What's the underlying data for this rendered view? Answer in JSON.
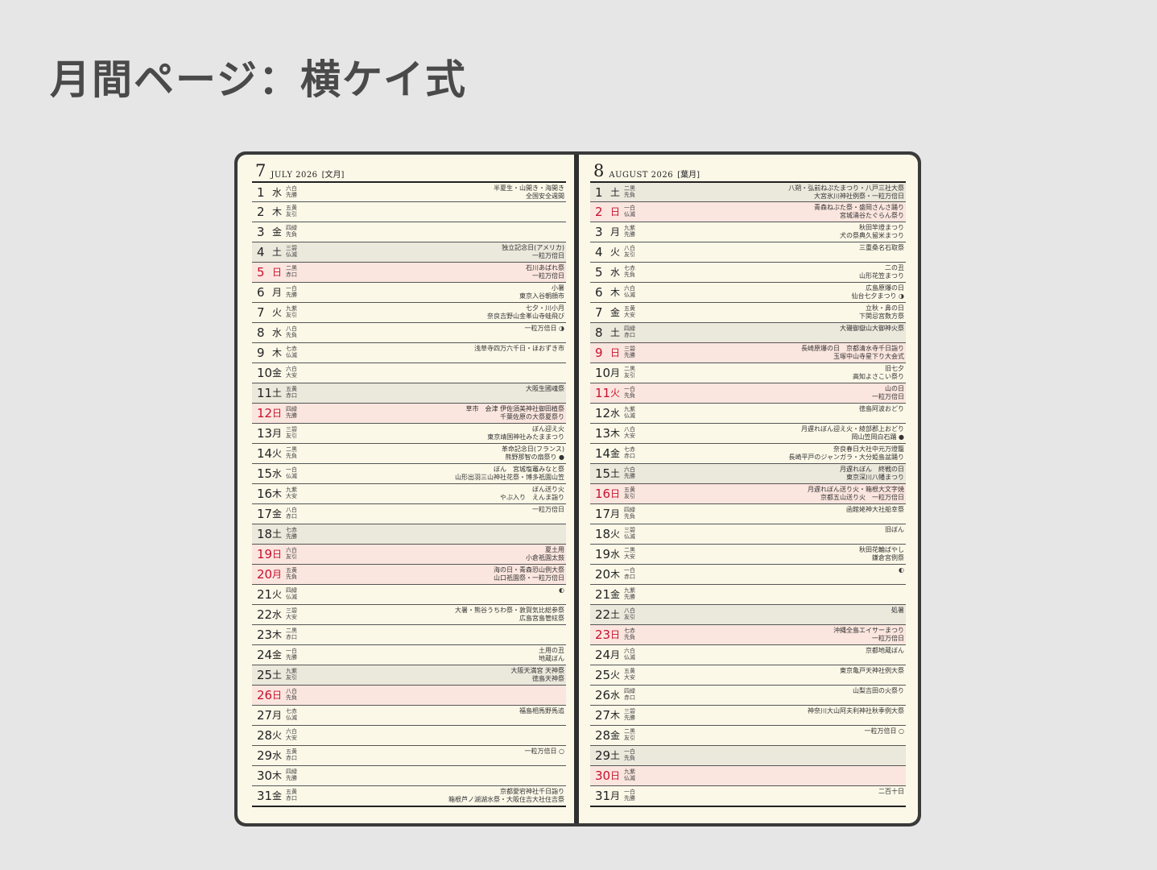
{
  "page_title": "月間ページ：横ケイ式",
  "months": [
    {
      "num": "7",
      "name": "JULY 2026",
      "jp": "[文月]",
      "days": [
        {
          "n": "1",
          "w": "水",
          "r1": "六白",
          "r2": "先勝",
          "e": [
            "半夏生・山開き・海開き",
            "全国安全週間"
          ],
          "t": "w"
        },
        {
          "n": "2",
          "w": "木",
          "r1": "五黄",
          "r2": "友引",
          "e": [],
          "t": "w"
        },
        {
          "n": "3",
          "w": "金",
          "r1": "四緑",
          "r2": "先負",
          "e": [],
          "t": "w"
        },
        {
          "n": "4",
          "w": "土",
          "r1": "三碧",
          "r2": "仏滅",
          "e": [
            "独立記念日(アメリカ)",
            "一粒万倍日"
          ],
          "t": "s"
        },
        {
          "n": "5",
          "w": "日",
          "r1": "二黒",
          "r2": "赤口",
          "e": [
            "石川あばれ祭",
            "一粒万倍日"
          ],
          "t": "h"
        },
        {
          "n": "6",
          "w": "月",
          "r1": "一白",
          "r2": "先勝",
          "e": [
            "小暑",
            "東京入谷朝顔市"
          ],
          "t": "w"
        },
        {
          "n": "7",
          "w": "火",
          "r1": "九紫",
          "r2": "友引",
          "e": [
            "七夕・川小月",
            "奈良吉野山金峯山寺蛙飛び"
          ],
          "t": "w"
        },
        {
          "n": "8",
          "w": "水",
          "r1": "八白",
          "r2": "先負",
          "e": [
            "",
            "一粒万倍日 ◑"
          ],
          "t": "w"
        },
        {
          "n": "9",
          "w": "木",
          "r1": "七赤",
          "r2": "仏滅",
          "e": [
            "浅草寺四万六千日・ほおずき市"
          ],
          "t": "w"
        },
        {
          "n": "10",
          "w": "金",
          "r1": "六白",
          "r2": "大安",
          "e": [],
          "t": "w"
        },
        {
          "n": "11",
          "w": "土",
          "r1": "五黄",
          "r2": "赤口",
          "e": [
            "大阪生國魂祭"
          ],
          "t": "s"
        },
        {
          "n": "12",
          "w": "日",
          "r1": "四緑",
          "r2": "先勝",
          "e": [
            "草市　会津 伊佐須美神社御田植祭",
            "千葉佐原の大祭夏祭り"
          ],
          "t": "h"
        },
        {
          "n": "13",
          "w": "月",
          "r1": "三碧",
          "r2": "友引",
          "e": [
            "ぼん迎え火",
            "東京靖国神社みたままつり"
          ],
          "t": "w"
        },
        {
          "n": "14",
          "w": "火",
          "r1": "二黒",
          "r2": "先負",
          "e": [
            "革命記念日(フランス)",
            "熊野那智の扇祭り ●"
          ],
          "t": "w"
        },
        {
          "n": "15",
          "w": "水",
          "r1": "一白",
          "r2": "仏滅",
          "e": [
            "ぼん　宮城塩竈みなと祭",
            "山形出羽三山神社花祭・博多祇園山笠"
          ],
          "t": "w"
        },
        {
          "n": "16",
          "w": "木",
          "r1": "九紫",
          "r2": "大安",
          "e": [
            "ぼん送り火",
            "やぶ入り　えんま詣り"
          ],
          "t": "w"
        },
        {
          "n": "17",
          "w": "金",
          "r1": "八白",
          "r2": "赤口",
          "e": [
            "",
            "一粒万倍日"
          ],
          "t": "w"
        },
        {
          "n": "18",
          "w": "土",
          "r1": "七赤",
          "r2": "先勝",
          "e": [],
          "t": "s"
        },
        {
          "n": "19",
          "w": "日",
          "r1": "六白",
          "r2": "友引",
          "e": [
            "夏土用",
            "小倉祇園太鼓"
          ],
          "t": "h"
        },
        {
          "n": "20",
          "w": "月",
          "r1": "五黄",
          "r2": "先負",
          "e": [
            "海の日・青森恐山例大祭",
            "山口祇園祭・一粒万倍日"
          ],
          "t": "h"
        },
        {
          "n": "21",
          "w": "火",
          "r1": "四緑",
          "r2": "仏滅",
          "e": [
            "",
            "◐"
          ],
          "t": "w"
        },
        {
          "n": "22",
          "w": "水",
          "r1": "三碧",
          "r2": "大安",
          "e": [
            "大暑・熊谷うちわ祭・敦賀気比総参祭",
            "広島宮島管絃祭"
          ],
          "t": "w"
        },
        {
          "n": "23",
          "w": "木",
          "r1": "二黒",
          "r2": "赤口",
          "e": [],
          "t": "w"
        },
        {
          "n": "24",
          "w": "金",
          "r1": "一白",
          "r2": "先勝",
          "e": [
            "土用の丑",
            "地蔵ぼん"
          ],
          "t": "w"
        },
        {
          "n": "25",
          "w": "土",
          "r1": "九紫",
          "r2": "友引",
          "e": [
            "大阪天満宮 天神祭",
            "徳島天神祭"
          ],
          "t": "s"
        },
        {
          "n": "26",
          "w": "日",
          "r1": "八白",
          "r2": "先負",
          "e": [],
          "t": "h"
        },
        {
          "n": "27",
          "w": "月",
          "r1": "七赤",
          "r2": "仏滅",
          "e": [
            "福島相馬野馬追"
          ],
          "t": "w"
        },
        {
          "n": "28",
          "w": "火",
          "r1": "六白",
          "r2": "大安",
          "e": [],
          "t": "w"
        },
        {
          "n": "29",
          "w": "水",
          "r1": "五黄",
          "r2": "赤口",
          "e": [
            "",
            "一粒万倍日 ○"
          ],
          "t": "w"
        },
        {
          "n": "30",
          "w": "木",
          "r1": "四緑",
          "r2": "先勝",
          "e": [],
          "t": "w"
        },
        {
          "n": "31",
          "w": "金",
          "r1": "五黄",
          "r2": "赤口",
          "e": [
            "京都愛宕神社千日詣り",
            "箱根芦ノ湖湖水祭・大阪住吉大社住吉祭"
          ],
          "t": "w"
        }
      ]
    },
    {
      "num": "8",
      "name": "AUGUST 2026",
      "jp": "[葉月]",
      "days": [
        {
          "n": "1",
          "w": "土",
          "r1": "二黒",
          "r2": "先負",
          "e": [
            "八朔・弘前ねぷたまつり・八戸三社大祭",
            "大宮氷川神社例祭・一粒万倍日"
          ],
          "t": "s"
        },
        {
          "n": "2",
          "w": "日",
          "r1": "一白",
          "r2": "仏滅",
          "e": [
            "青森ねぶた祭・盛岡さんさ踊り",
            "宮城涌谷たぐらん祭り"
          ],
          "t": "h"
        },
        {
          "n": "3",
          "w": "月",
          "r1": "九紫",
          "r2": "先勝",
          "e": [
            "秋田竿燈まつり",
            "犬の祭典久留米まつり"
          ],
          "t": "w"
        },
        {
          "n": "4",
          "w": "火",
          "r1": "八白",
          "r2": "友引",
          "e": [
            "三重桑名石取祭"
          ],
          "t": "w"
        },
        {
          "n": "5",
          "w": "水",
          "r1": "七赤",
          "r2": "先負",
          "e": [
            "二の丑",
            "山形花笠まつり"
          ],
          "t": "w"
        },
        {
          "n": "6",
          "w": "木",
          "r1": "六白",
          "r2": "仏滅",
          "e": [
            "広島原爆の日",
            "仙台七夕まつり ◑"
          ],
          "t": "w"
        },
        {
          "n": "7",
          "w": "金",
          "r1": "五黄",
          "r2": "大安",
          "e": [
            "立秋・鼻の日",
            "下関忌宮数方祭"
          ],
          "t": "w"
        },
        {
          "n": "8",
          "w": "土",
          "r1": "四緑",
          "r2": "赤口",
          "e": [
            "大磯御嶽山大御神火祭"
          ],
          "t": "s"
        },
        {
          "n": "9",
          "w": "日",
          "r1": "三碧",
          "r2": "先勝",
          "e": [
            "長崎原爆の日　京都清水寺千日詣り",
            "玉塚中山寺星下り大会式"
          ],
          "t": "h"
        },
        {
          "n": "10",
          "w": "月",
          "r1": "二黒",
          "r2": "友引",
          "e": [
            "旧七夕",
            "高知よさこい祭り"
          ],
          "t": "w"
        },
        {
          "n": "11",
          "w": "火",
          "r1": "一白",
          "r2": "先負",
          "e": [
            "山の日",
            "一粒万倍日"
          ],
          "t": "h"
        },
        {
          "n": "12",
          "w": "水",
          "r1": "九紫",
          "r2": "仏滅",
          "e": [
            "徳島阿波おどり"
          ],
          "t": "w"
        },
        {
          "n": "13",
          "w": "木",
          "r1": "八白",
          "r2": "大安",
          "e": [
            "月遅れぼん迎え火・綾部郡上おどり",
            "岡山笠岡白石踊 ●"
          ],
          "t": "w"
        },
        {
          "n": "14",
          "w": "金",
          "r1": "七赤",
          "r2": "赤口",
          "e": [
            "奈良春日大社中元万燈籠",
            "長崎平戸のジャンガラ・大分姫島盆踊り"
          ],
          "t": "w"
        },
        {
          "n": "15",
          "w": "土",
          "r1": "六白",
          "r2": "先勝",
          "e": [
            "月遅れぼん　終戦の日",
            "東京深川八幡まつり"
          ],
          "t": "s"
        },
        {
          "n": "16",
          "w": "日",
          "r1": "五黄",
          "r2": "友引",
          "e": [
            "月遅れぼん送り火・箱根大文字焼",
            "京都五山送り火　一粒万倍日"
          ],
          "t": "h"
        },
        {
          "n": "17",
          "w": "月",
          "r1": "四緑",
          "r2": "先負",
          "e": [
            "函館姥神大社船幸祭"
          ],
          "t": "w"
        },
        {
          "n": "18",
          "w": "火",
          "r1": "三碧",
          "r2": "仏滅",
          "e": [
            "旧ぼん"
          ],
          "t": "w"
        },
        {
          "n": "19",
          "w": "水",
          "r1": "二黒",
          "r2": "大安",
          "e": [
            "秋田花輪ばやし",
            "鎌倉宮例祭"
          ],
          "t": "w"
        },
        {
          "n": "20",
          "w": "木",
          "r1": "一白",
          "r2": "赤口",
          "e": [
            "",
            "◐"
          ],
          "t": "w"
        },
        {
          "n": "21",
          "w": "金",
          "r1": "九紫",
          "r2": "先勝",
          "e": [],
          "t": "w"
        },
        {
          "n": "22",
          "w": "土",
          "r1": "八白",
          "r2": "友引",
          "e": [
            "処暑"
          ],
          "t": "s"
        },
        {
          "n": "23",
          "w": "日",
          "r1": "七赤",
          "r2": "先負",
          "e": [
            "沖縄全島エイサーまつり",
            "一粒万倍日"
          ],
          "t": "h"
        },
        {
          "n": "24",
          "w": "月",
          "r1": "六白",
          "r2": "仏滅",
          "e": [
            "京都地蔵ぼん"
          ],
          "t": "w"
        },
        {
          "n": "25",
          "w": "火",
          "r1": "五黄",
          "r2": "大安",
          "e": [
            "東京亀戸天神社例大祭"
          ],
          "t": "w"
        },
        {
          "n": "26",
          "w": "水",
          "r1": "四緑",
          "r2": "赤口",
          "e": [
            "山梨吉田の火祭り"
          ],
          "t": "w"
        },
        {
          "n": "27",
          "w": "木",
          "r1": "三碧",
          "r2": "先勝",
          "e": [
            "神奈川大山阿夫利神社秋季例大祭"
          ],
          "t": "w"
        },
        {
          "n": "28",
          "w": "金",
          "r1": "二黒",
          "r2": "友引",
          "e": [
            "",
            "一粒万倍日 ○"
          ],
          "t": "w"
        },
        {
          "n": "29",
          "w": "土",
          "r1": "一白",
          "r2": "先負",
          "e": [],
          "t": "s"
        },
        {
          "n": "30",
          "w": "日",
          "r1": "九紫",
          "r2": "仏滅",
          "e": [],
          "t": "h"
        },
        {
          "n": "31",
          "w": "月",
          "r1": "一白",
          "r2": "先勝",
          "e": [
            "二百十日"
          ],
          "t": "w"
        }
      ]
    }
  ]
}
